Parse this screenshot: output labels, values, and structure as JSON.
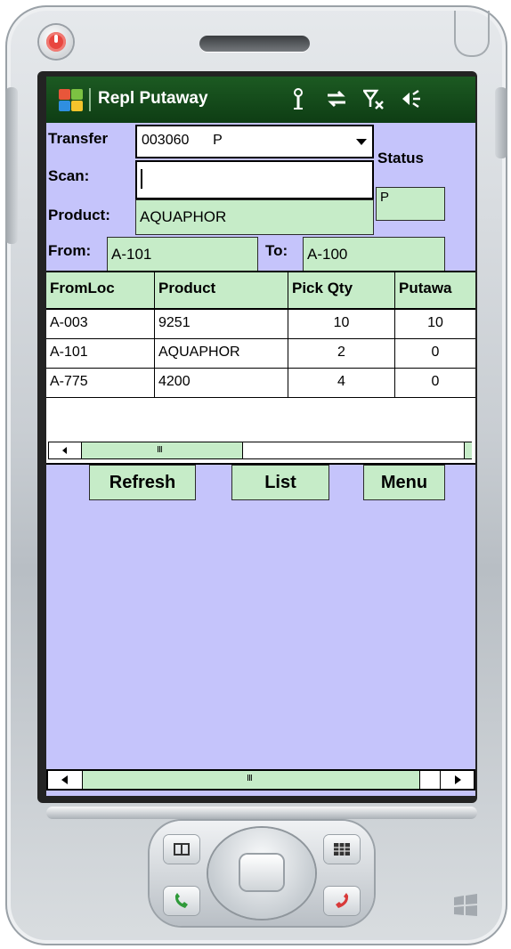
{
  "app": {
    "title": "Repl Putaway",
    "colors": {
      "titlebar": "#124817",
      "screen": "#c5c4fb",
      "field": "#c6ecc8"
    }
  },
  "form": {
    "transfer_label": "Transfer",
    "transfer_value": "003060      P",
    "scan_label": "Scan:",
    "scan_value": "",
    "product_label": "Product:",
    "product_value": "AQUAPHOR",
    "status_label": "Status",
    "status_value": "P",
    "from_label": "From:",
    "from_value": "A-101",
    "to_label": "To:",
    "to_value": "A-100"
  },
  "grid": {
    "columns": [
      "FromLoc",
      "Product",
      "Pick Qty",
      "Putawa"
    ],
    "rows": [
      [
        "A-003",
        "9251",
        "10",
        "10"
      ],
      [
        "A-101",
        "AQUAPHOR",
        "2",
        "0"
      ],
      [
        "A-775",
        "4200",
        "4",
        "0"
      ]
    ],
    "scroll_grip": "III"
  },
  "buttons": {
    "refresh": "Refresh",
    "list": "List",
    "menu": "Menu"
  },
  "bottom_scroll_grip": "III",
  "icons": [
    "windows-logo-icon",
    "antenna-icon",
    "sync-icon",
    "signal-off-icon",
    "speaker-icon",
    "power-icon",
    "start-icon",
    "ok-grid-icon",
    "call-icon",
    "end-call-icon",
    "windows-mark-icon"
  ]
}
